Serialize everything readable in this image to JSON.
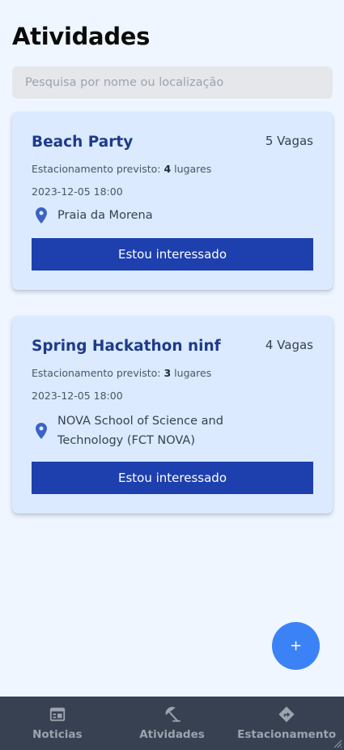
{
  "page": {
    "title": "Atividades"
  },
  "search": {
    "placeholder": "Pesquisa por nome ou localização",
    "value": ""
  },
  "activities": [
    {
      "title": "Beach Party",
      "vagas": "5 Vagas",
      "parking_prefix": "Estacionamento previsto:",
      "parking_count": "4",
      "parking_suffix": "lugares",
      "datetime": "2023-12-05 18:00",
      "location": "Praia da Morena",
      "button_label": "Estou interessado"
    },
    {
      "title": "Spring Hackathon ninf",
      "vagas": "4 Vagas",
      "parking_prefix": "Estacionamento previsto:",
      "parking_count": "3",
      "parking_suffix": "lugares",
      "datetime": "2023-12-05 18:00",
      "location": "NOVA School of Science and Technology (FCT NOVA)",
      "button_label": "Estou interessado"
    }
  ],
  "fab": {
    "label": "+"
  },
  "bottom_nav": {
    "items": [
      {
        "label": "Noticias",
        "icon": "newspaper-icon"
      },
      {
        "label": "Atividades",
        "icon": "umbrella-beach-icon"
      },
      {
        "label": "Estacionamento",
        "icon": "directions-icon"
      }
    ]
  },
  "colors": {
    "background": "#eff6ff",
    "card": "#dbeafe",
    "card_title": "#1e3a8a",
    "button": "#1e40af",
    "fab": "#3b82f6",
    "pin": "#3b63c4",
    "nav_background": "#374151",
    "nav_text": "#9ca3af"
  }
}
